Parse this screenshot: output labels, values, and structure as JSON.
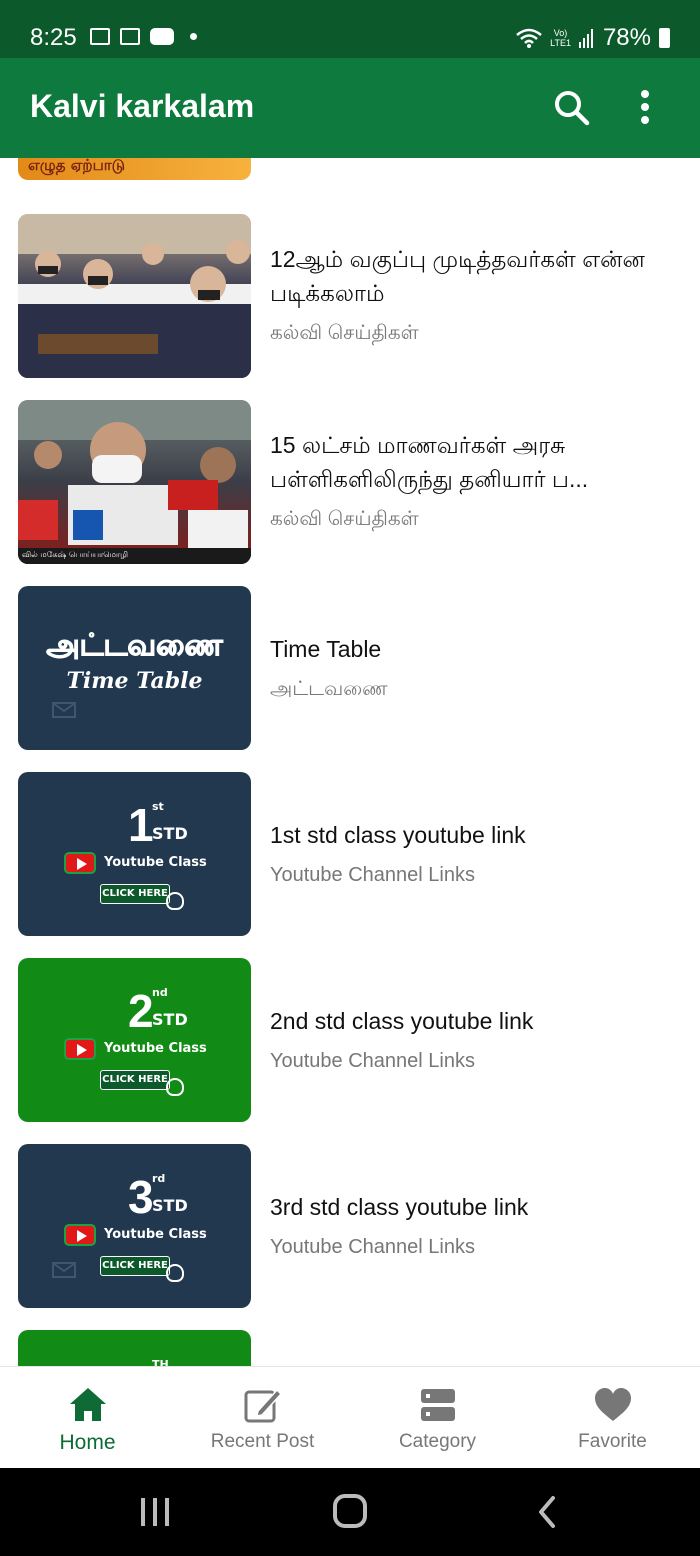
{
  "status_bar": {
    "time": "8:25",
    "lte_top": "Vo)",
    "lte_bottom": "LTE1",
    "battery": "78%"
  },
  "app_bar": {
    "title": "Kalvi karkalam",
    "search_icon": "search-icon",
    "menu_icon": "more-vert-icon"
  },
  "colors": {
    "status_bar": "#0c5a2c",
    "app_bar": "#0e7a3d",
    "accent": "#0e6b35"
  },
  "partial_top": {
    "banner_text": "எழுத ஏற்பாடு"
  },
  "posts": [
    {
      "title": "12ஆம் வகுப்பு முடித்தவர்கள் என்ன படிக்கலாம்",
      "category": "கல்வி செய்திகள்"
    },
    {
      "title": "15 லட்சம் மாணவர்கள் அரசு பள்ளிகளிலிருந்து தனியார் ப...",
      "category": "கல்வி செய்திகள்",
      "thumb_caption": "வில் மகேஷ் பொய்யாமொழி"
    },
    {
      "title": "Time Table",
      "category": "அட்டவணை",
      "thumb_word": "அட்டவணை",
      "thumb_sub": "Time Table"
    },
    {
      "title": "1st std class youtube link",
      "category": "Youtube Channel Links",
      "std_num": "1",
      "std_sup": "st",
      "std_std": "STD",
      "yt_label": "Youtube Class",
      "click_label": "CLICK HERE"
    },
    {
      "title": "2nd std class youtube link",
      "category": "Youtube Channel Links",
      "std_num": "2",
      "std_sup": "nd",
      "std_std": "STD",
      "yt_label": "Youtube Class",
      "click_label": "CLICK HERE"
    },
    {
      "title": "3rd std class youtube link",
      "category": "Youtube Channel Links",
      "std_num": "3",
      "std_sup": "rd",
      "std_std": "STD",
      "yt_label": "Youtube Class",
      "click_label": "CLICK HERE"
    }
  ],
  "partial_bottom": {
    "std_sup": "TH"
  },
  "bottom_nav": [
    {
      "label": "Home",
      "icon": "home-icon",
      "active": true
    },
    {
      "label": "Recent Post",
      "icon": "edit-icon",
      "active": false
    },
    {
      "label": "Category",
      "icon": "category-icon",
      "active": false
    },
    {
      "label": "Favorite",
      "icon": "heart-icon",
      "active": false
    }
  ]
}
